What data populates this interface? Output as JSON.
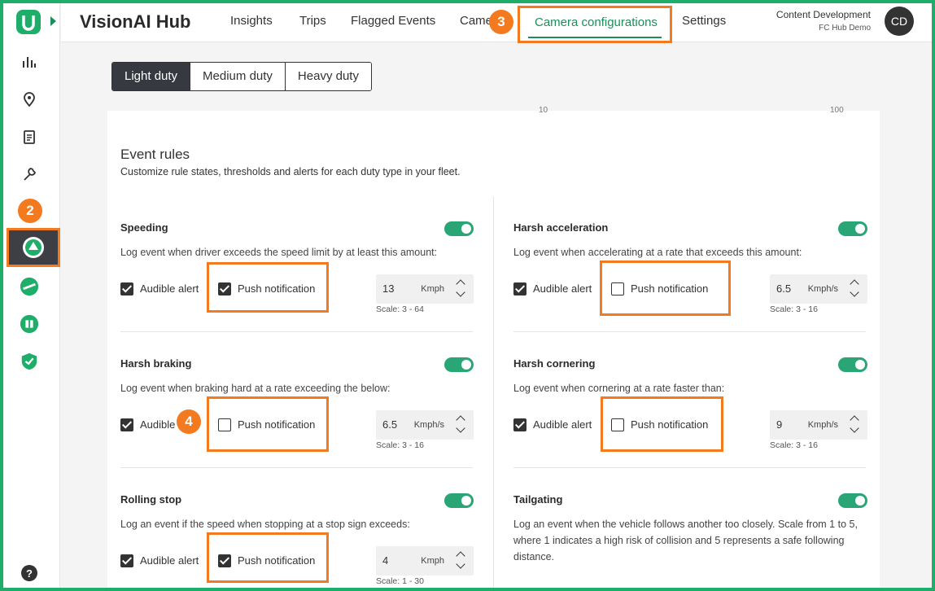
{
  "app": {
    "title": "VisionAI Hub"
  },
  "nav": {
    "insights": "Insights",
    "trips": "Trips",
    "flagged": "Flagged Events",
    "cameras": "Came",
    "camera_config": "Camera configurations",
    "settings": "Settings"
  },
  "user": {
    "name": "Content Development",
    "org": "FC Hub Demo",
    "initials": "CD"
  },
  "badges": {
    "b2": "2",
    "b3": "3",
    "b4": "4"
  },
  "duty_tabs": [
    "Light duty",
    "Medium duty",
    "Heavy duty"
  ],
  "slider_ticks": {
    "left": "10",
    "right": "100"
  },
  "event_rules": {
    "title": "Event rules",
    "description": "Customize rule states, thresholds and alerts for each duty type in your fleet."
  },
  "labels": {
    "audible": "Audible alert",
    "audible_short": "Audible",
    "push": "Push notification"
  },
  "rules": {
    "speeding": {
      "title": "Speeding",
      "desc": "Log event when driver exceeds the speed limit by at least this amount:",
      "value": "13",
      "unit": "Kmph",
      "scale": "Scale: 3 - 64"
    },
    "harsh_acceleration": {
      "title": "Harsh acceleration",
      "desc": "Log event when accelerating at a rate that exceeds this amount:",
      "value": "6.5",
      "unit": "Kmph/s",
      "scale": "Scale: 3 - 16"
    },
    "harsh_braking": {
      "title": "Harsh braking",
      "desc": "Log event when braking hard at a rate exceeding the below:",
      "value": "6.5",
      "unit": "Kmph/s",
      "scale": "Scale: 3 - 16"
    },
    "harsh_cornering": {
      "title": "Harsh cornering",
      "desc": "Log event when cornering at a rate faster than:",
      "value": "9",
      "unit": "Kmph/s",
      "scale": "Scale: 3 - 16"
    },
    "rolling_stop": {
      "title": "Rolling stop",
      "desc": "Log an event if the speed when stopping at a stop sign exceeds:",
      "value": "4",
      "unit": "Kmph",
      "scale": "Scale: 1 - 30"
    },
    "tailgating": {
      "title": "Tailgating",
      "desc": "Log an event when the vehicle follows another too closely. Scale from 1 to 5, where 1 indicates a high risk of collision and 5 represents a safe following distance."
    }
  },
  "colors": {
    "accent": "#1b8f5a",
    "toggle": "#2aa676",
    "highlight": "#f37a1f",
    "frame": "#1fae6a"
  }
}
